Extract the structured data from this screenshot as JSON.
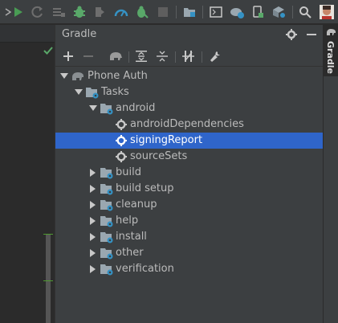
{
  "toolbar": {
    "icons": [
      "run-icon",
      "rerun-icon",
      "stop-list-icon",
      "debug-icon",
      "coverage-icon",
      "profiler-icon",
      "attach-debugger-icon",
      "stop-icon",
      "project-structure-icon",
      "terminal-icon",
      "sync-icon",
      "device-manager-icon",
      "sdk-manager-icon",
      "search-icon",
      "user-avatar"
    ],
    "colors": {
      "run": "#499c54",
      "debug": "#59a869",
      "stop": "#6e6e6e",
      "accent": "#3592c4"
    }
  },
  "panel": {
    "title": "Gradle",
    "toolbar": [
      "add-icon",
      "remove-icon",
      "elephant-icon",
      "expand-all-icon",
      "collapse-all-icon",
      "toggle-offline-icon",
      "wrench-icon"
    ]
  },
  "tree": [
    {
      "label": "Phone Auth",
      "level": 0,
      "expanded": true,
      "icon": "gradle-elephant-icon"
    },
    {
      "label": "Tasks",
      "level": 1,
      "expanded": true,
      "icon": "folder-gear-icon"
    },
    {
      "label": "android",
      "level": 2,
      "expanded": true,
      "icon": "folder-gear-icon"
    },
    {
      "label": "androidDependencies",
      "level": 3,
      "icon": "gear-icon"
    },
    {
      "label": "signingReport",
      "level": 3,
      "icon": "gear-icon",
      "selected": true
    },
    {
      "label": "sourceSets",
      "level": 3,
      "icon": "gear-icon"
    },
    {
      "label": "build",
      "level": 2,
      "expanded": false,
      "icon": "folder-gear-icon"
    },
    {
      "label": "build setup",
      "level": 2,
      "expanded": false,
      "icon": "folder-gear-icon"
    },
    {
      "label": "cleanup",
      "level": 2,
      "expanded": false,
      "icon": "folder-gear-icon"
    },
    {
      "label": "help",
      "level": 2,
      "expanded": false,
      "icon": "folder-gear-icon"
    },
    {
      "label": "install",
      "level": 2,
      "expanded": false,
      "icon": "folder-gear-icon"
    },
    {
      "label": "other",
      "level": 2,
      "expanded": false,
      "icon": "folder-gear-icon"
    },
    {
      "label": "verification",
      "level": 2,
      "expanded": false,
      "icon": "folder-gear-icon"
    }
  ],
  "stripe": {
    "label": "Gradle"
  },
  "colors": {
    "selection": "#2f65ca",
    "panel_bg": "#3c3f41",
    "editor_bg": "#2b2b2b",
    "text": "#bbbbbb"
  }
}
